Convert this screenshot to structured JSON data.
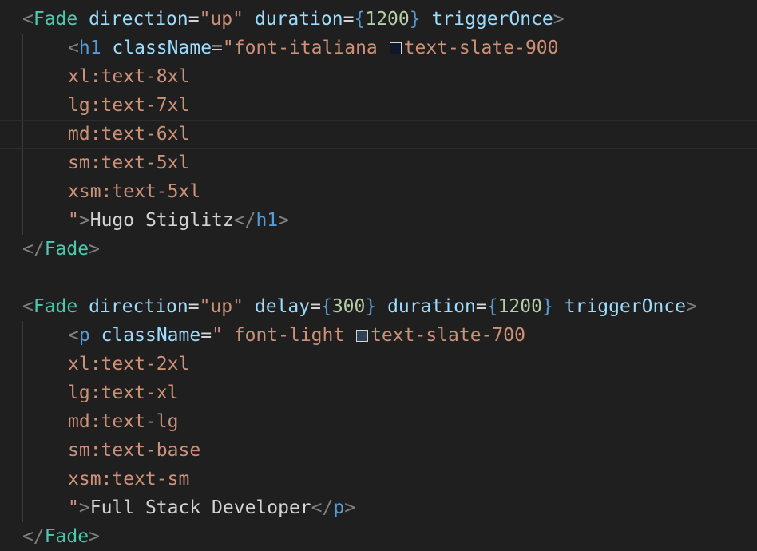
{
  "editor": {
    "lines": [
      {
        "i": 0,
        "tokens": [
          {
            "t": "<",
            "c": "punct"
          },
          {
            "t": "Fade",
            "c": "tag"
          },
          {
            "t": " "
          },
          {
            "t": "direction",
            "c": "attr"
          },
          {
            "t": "=",
            "c": "op"
          },
          {
            "t": "\"up\"",
            "c": "str"
          },
          {
            "t": " "
          },
          {
            "t": "duration",
            "c": "attr"
          },
          {
            "t": "=",
            "c": "op"
          },
          {
            "t": "{",
            "c": "brace"
          },
          {
            "t": "1200",
            "c": "num"
          },
          {
            "t": "}",
            "c": "brace"
          },
          {
            "t": " "
          },
          {
            "t": "triggerOnce",
            "c": "attr"
          },
          {
            "t": ">",
            "c": "punct"
          }
        ]
      },
      {
        "i": 1,
        "tokens": [
          {
            "t": "<",
            "c": "punct"
          },
          {
            "t": "h1",
            "c": "html"
          },
          {
            "t": " "
          },
          {
            "t": "className",
            "c": "attr"
          },
          {
            "t": "=",
            "c": "op"
          },
          {
            "t": "\"font-italiana ",
            "c": "str"
          },
          {
            "swatch": "#0f172a"
          },
          {
            "t": "text-slate-900",
            "c": "str"
          }
        ]
      },
      {
        "i": 1,
        "tokens": [
          {
            "t": "xl:text-8xl",
            "c": "str"
          }
        ]
      },
      {
        "i": 1,
        "tokens": [
          {
            "t": "lg:text-7xl",
            "c": "str"
          }
        ]
      },
      {
        "i": 1,
        "current": true,
        "tokens": [
          {
            "t": "md:text-6xl",
            "c": "str"
          }
        ]
      },
      {
        "i": 1,
        "tokens": [
          {
            "t": "sm:text-5xl",
            "c": "str"
          }
        ]
      },
      {
        "i": 1,
        "tokens": [
          {
            "t": "xsm:text-5xl",
            "c": "str"
          }
        ]
      },
      {
        "i": 1,
        "tokens": [
          {
            "t": "\"",
            "c": "str"
          },
          {
            "t": ">",
            "c": "punct"
          },
          {
            "t": "Hugo Stiglitz",
            "c": "text"
          },
          {
            "t": "</",
            "c": "punct"
          },
          {
            "t": "h1",
            "c": "html"
          },
          {
            "t": ">",
            "c": "punct"
          }
        ]
      },
      {
        "i": 0,
        "tokens": [
          {
            "t": "</",
            "c": "punct"
          },
          {
            "t": "Fade",
            "c": "tag"
          },
          {
            "t": ">",
            "c": "punct"
          }
        ]
      },
      {
        "i": 0,
        "tokens": []
      },
      {
        "i": 0,
        "tokens": [
          {
            "t": "<",
            "c": "punct"
          },
          {
            "t": "Fade",
            "c": "tag"
          },
          {
            "t": " "
          },
          {
            "t": "direction",
            "c": "attr"
          },
          {
            "t": "=",
            "c": "op"
          },
          {
            "t": "\"up\"",
            "c": "str"
          },
          {
            "t": " "
          },
          {
            "t": "delay",
            "c": "attr"
          },
          {
            "t": "=",
            "c": "op"
          },
          {
            "t": "{",
            "c": "brace"
          },
          {
            "t": "300",
            "c": "num"
          },
          {
            "t": "}",
            "c": "brace"
          },
          {
            "t": " "
          },
          {
            "t": "duration",
            "c": "attr"
          },
          {
            "t": "=",
            "c": "op"
          },
          {
            "t": "{",
            "c": "brace"
          },
          {
            "t": "1200",
            "c": "num"
          },
          {
            "t": "}",
            "c": "brace"
          },
          {
            "t": " "
          },
          {
            "t": "triggerOnce",
            "c": "attr"
          },
          {
            "t": ">",
            "c": "punct"
          }
        ]
      },
      {
        "i": 1,
        "tokens": [
          {
            "t": "<",
            "c": "punct"
          },
          {
            "t": "p",
            "c": "html"
          },
          {
            "t": " "
          },
          {
            "t": "className",
            "c": "attr"
          },
          {
            "t": "=",
            "c": "op"
          },
          {
            "t": "\" font-light ",
            "c": "str"
          },
          {
            "swatch": "#334155"
          },
          {
            "t": "text-slate-700",
            "c": "str"
          }
        ]
      },
      {
        "i": 1,
        "tokens": [
          {
            "t": "xl:text-2xl",
            "c": "str"
          }
        ]
      },
      {
        "i": 1,
        "tokens": [
          {
            "t": "lg:text-xl",
            "c": "str"
          }
        ]
      },
      {
        "i": 1,
        "tokens": [
          {
            "t": "md:text-lg",
            "c": "str"
          }
        ]
      },
      {
        "i": 1,
        "tokens": [
          {
            "t": "sm:text-base",
            "c": "str"
          }
        ]
      },
      {
        "i": 1,
        "tokens": [
          {
            "t": "xsm:text-sm",
            "c": "str"
          }
        ]
      },
      {
        "i": 1,
        "tokens": [
          {
            "t": "\"",
            "c": "str"
          },
          {
            "t": ">",
            "c": "punct"
          },
          {
            "t": "Full Stack Developer",
            "c": "text"
          },
          {
            "t": "</",
            "c": "punct"
          },
          {
            "t": "p",
            "c": "html"
          },
          {
            "t": ">",
            "c": "punct"
          }
        ]
      },
      {
        "i": 0,
        "tokens": [
          {
            "t": "</",
            "c": "punct"
          },
          {
            "t": "Fade",
            "c": "tag"
          },
          {
            "t": ">",
            "c": "punct"
          }
        ]
      }
    ]
  }
}
